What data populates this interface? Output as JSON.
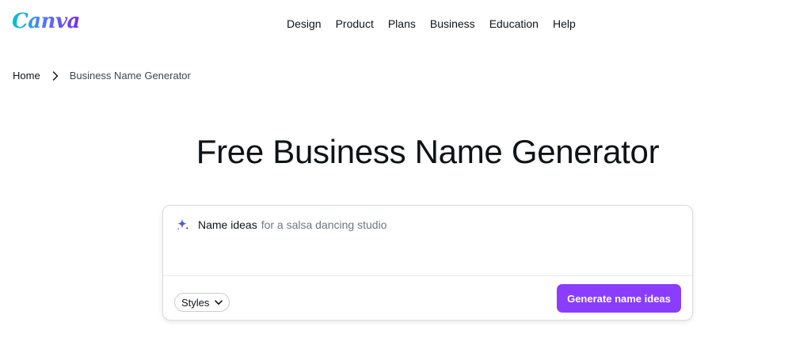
{
  "header": {
    "logo_text": "Canva",
    "nav": [
      {
        "label": "Design"
      },
      {
        "label": "Product"
      },
      {
        "label": "Plans"
      },
      {
        "label": "Business"
      },
      {
        "label": "Education"
      },
      {
        "label": "Help"
      }
    ]
  },
  "breadcrumb": {
    "home": "Home",
    "current": "Business Name Generator"
  },
  "main": {
    "title": "Free Business Name Generator"
  },
  "generator": {
    "prompt_label": "Name ideas",
    "placeholder": "for a salsa dancing studio",
    "styles_label": "Styles",
    "generate_label": "Generate name ideas"
  },
  "icons": {
    "breadcrumb_separator": "chevron-right-icon",
    "prompt": "sparkle-icon",
    "styles_dropdown": "chevron-down-icon"
  },
  "colors": {
    "brand_gradient_start": "#00c4cc",
    "brand_gradient_end": "#7d2ae8",
    "primary_button": "#8b3dff",
    "sparkle_icon": "#4f5bd5"
  }
}
